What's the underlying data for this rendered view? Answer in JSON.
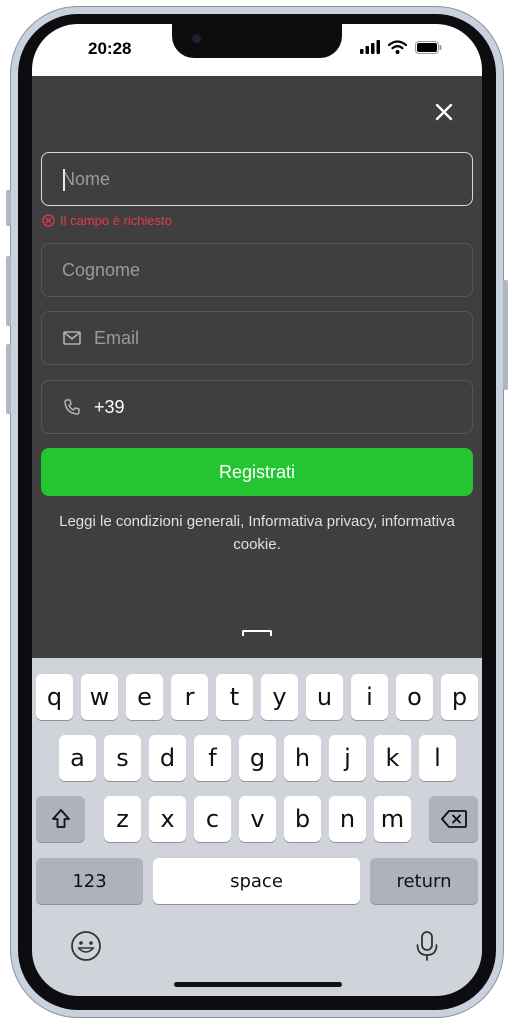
{
  "status": {
    "time": "20:28"
  },
  "form": {
    "first_name": {
      "placeholder": "Nome",
      "value": ""
    },
    "error": "Il campo è richiesto",
    "last_name": {
      "placeholder": "Cognome",
      "value": ""
    },
    "email": {
      "placeholder": "Email",
      "value": ""
    },
    "phone": {
      "prefix": "+39"
    },
    "submit_label": "Registrati",
    "legal_text": "Leggi le condizioni generali, Informativa privacy, informativa cookie."
  },
  "keyboard": {
    "row1": [
      "q",
      "w",
      "e",
      "r",
      "t",
      "y",
      "u",
      "i",
      "o",
      "p"
    ],
    "row2": [
      "a",
      "s",
      "d",
      "f",
      "g",
      "h",
      "j",
      "k",
      "l"
    ],
    "row3": [
      "z",
      "x",
      "c",
      "v",
      "b",
      "n",
      "m"
    ],
    "numbers_label": "123",
    "space_label": "space",
    "return_label": "return"
  },
  "colors": {
    "background": "#3f3f41",
    "accent_green": "#23c530",
    "error_red": "#e33b48"
  }
}
